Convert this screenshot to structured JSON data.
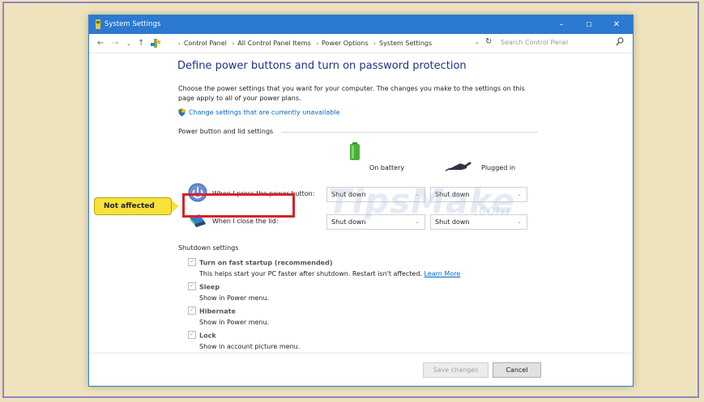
{
  "window": {
    "title": "System Settings",
    "minimize": "–",
    "maximize": "☐",
    "close": "✕"
  },
  "addressbar": {
    "crumbs": [
      "Control Panel",
      "All Control Panel Items",
      "Power Options",
      "System Settings"
    ],
    "search_placeholder": "Search Control Panel"
  },
  "page": {
    "heading": "Define power buttons and turn on password protection",
    "description": "Choose the power settings that you want for your computer. The changes you make to the settings on this page apply to all of your power plans.",
    "change_link": "Change settings that are currently unavailable"
  },
  "power_section": {
    "title": "Power button and lid settings",
    "col_battery": "On battery",
    "col_plugged": "Plugged in",
    "rows": [
      {
        "label": "When I press the power button:",
        "battery": "Shut down",
        "plugged": "Shut down"
      },
      {
        "label": "When I close the lid:",
        "battery": "Shut down",
        "plugged": "Shut down"
      }
    ]
  },
  "shutdown_section": {
    "title": "Shutdown settings",
    "items": [
      {
        "title": "Turn on fast startup (recommended)",
        "desc": "This helps start your PC faster after shutdown. Restart isn't affected.",
        "link": "Learn More",
        "checked": true
      },
      {
        "title": "Sleep",
        "desc": "Show in Power menu.",
        "checked": true
      },
      {
        "title": "Hibernate",
        "desc": "Show in Power menu.",
        "checked": true
      },
      {
        "title": "Lock",
        "desc": "Show in account picture menu.",
        "checked": true
      }
    ]
  },
  "footer": {
    "save": "Save changes",
    "cancel": "Cancel"
  },
  "annotation": {
    "callout": "Not affected"
  },
  "watermark": {
    "brand": "TipsMake",
    "suffix": ".com"
  },
  "colors": {
    "titlebar": "#2b79d1",
    "heading": "#1e3287",
    "link": "#0066cc",
    "callout": "#f6e23a",
    "highlight": "#d6232a"
  }
}
